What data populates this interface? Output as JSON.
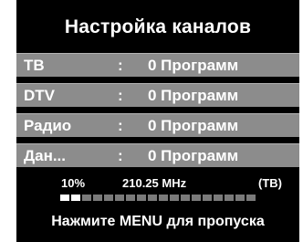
{
  "title": "Настройка каналов",
  "channels": [
    {
      "label": "ТВ",
      "sep": ":",
      "value": "0 Программ"
    },
    {
      "label": "DTV",
      "sep": ":",
      "value": "0 Программ"
    },
    {
      "label": "Радио",
      "sep": ":",
      "value": "0 Программ"
    },
    {
      "label": "Дан...",
      "sep": ":",
      "value": "0 Программ"
    }
  ],
  "status": {
    "percent": "10%",
    "frequency": "210.25 MHz",
    "mode": "(ТВ)"
  },
  "progress": {
    "fraction": 0.1,
    "segments": 18,
    "filled": 2
  },
  "hint": "Нажмите MENU для пропуска",
  "colors": {
    "background": "#000000",
    "row": "#8c8c8c",
    "text": "#ffffff",
    "progress_empty": "#7a7a7a",
    "progress_filled": "#ffffff"
  }
}
